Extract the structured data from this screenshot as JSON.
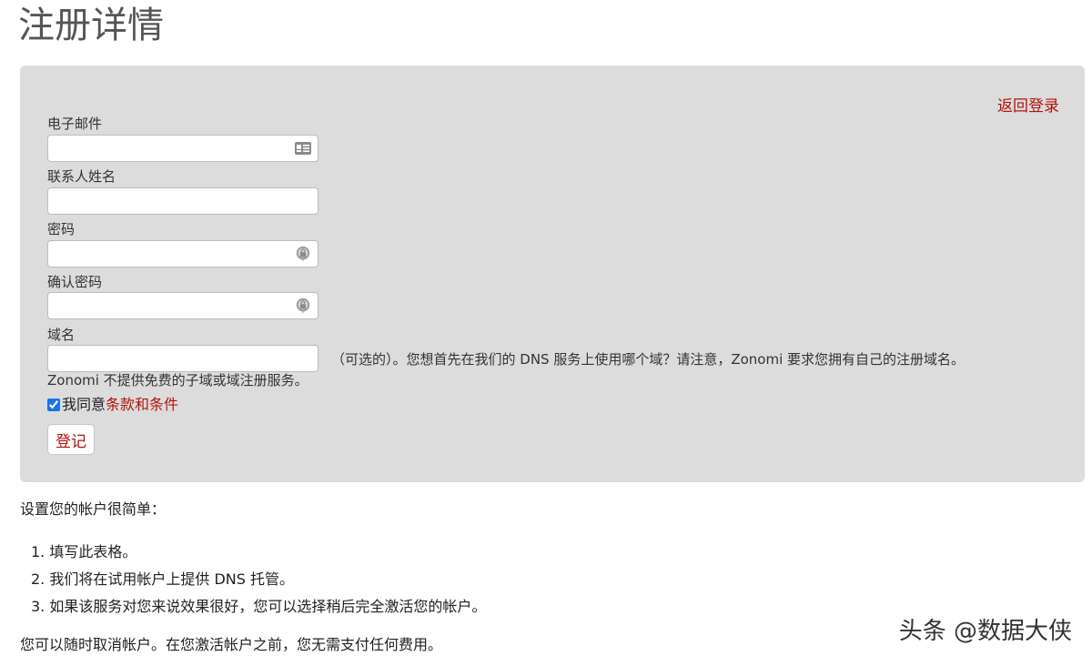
{
  "page": {
    "title": "注册详情"
  },
  "form": {
    "back_link": "返回登录",
    "email": {
      "label": "电子邮件",
      "value": "",
      "placeholder": "",
      "icon": "contact-card-icon"
    },
    "contact_name": {
      "label": "联系人姓名",
      "value": "",
      "placeholder": ""
    },
    "password": {
      "label": "密码",
      "value": "",
      "placeholder": "",
      "icon": "password-key-icon"
    },
    "confirm_password": {
      "label": "确认密码",
      "value": "",
      "placeholder": "",
      "icon": "password-key-icon"
    },
    "domain": {
      "label": "域名",
      "value": "",
      "hint_line1": "（可选的）。您想首先在我们的 DNS 服务上使用哪个域？请注意，Zonomi 要求您拥有自己的注册域名。",
      "hint_line2": "Zonomi 不提供免费的子域或域注册服务。"
    },
    "agree": {
      "checked": true,
      "prefix": "我同意",
      "link": "条款和条件"
    },
    "submit_label": "登记"
  },
  "info": {
    "intro": "设置您的帐户很简单：",
    "steps": [
      "1. 填写此表格。",
      "2. 我们将在试用帐户上提供 DNS 托管。",
      "3. 如果该服务对您来说效果很好，您可以选择稍后完全激活您的帐户。"
    ],
    "footer": "您可以随时取消帐户。在您激活帐户之前，您无需支付任何费用。"
  },
  "watermark": "头条 @数据大侠",
  "colors": {
    "link": "#b3120c",
    "panel": "#dcdcdc"
  }
}
